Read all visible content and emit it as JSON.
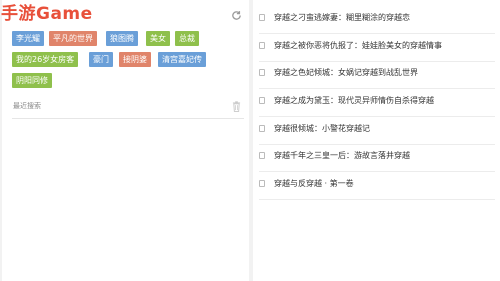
{
  "watermark": "手游Game",
  "search": {
    "tags": [
      {
        "label": "李光耀",
        "color": "#6a9fd8"
      },
      {
        "label": "平凡的世界",
        "color": "#e0846a"
      },
      {
        "label": "狼图腾",
        "color": "#6a9fd8"
      },
      {
        "label": "美女",
        "color": "#8fc04c"
      },
      {
        "label": "总裁",
        "color": "#8fc04c"
      },
      {
        "label": "我的26岁女房客",
        "color": "#8fc04c"
      },
      {
        "label": "豪门",
        "color": "#6a9fd8"
      },
      {
        "label": "接阴婆",
        "color": "#e0846a"
      },
      {
        "label": "清宫嘉妃传",
        "color": "#6a9fd8"
      },
      {
        "label": "阴阳同修",
        "color": "#8fc04c"
      }
    ],
    "recent_label": "最近搜索"
  },
  "results": [
    "穿越之刁蛮逃嫁妻：糊里糊涂的穿越恋",
    "穿越之被你恶将仇报了：娃娃脸美女的穿越情事",
    "穿越之色妃倾城：女娲记穿越到战乱世界",
    "穿越之成为黛玉：现代灵异师情伤自杀得穿越",
    "穿越很倾城：小警花穿越记",
    "穿越千年之三皇一后：游故言落井穿越",
    "穿越与反穿越 · 第一卷"
  ]
}
